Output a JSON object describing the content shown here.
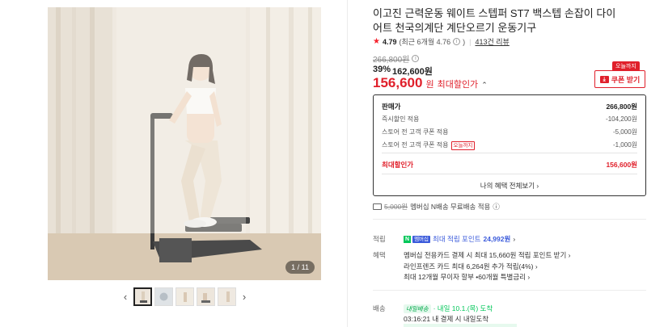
{
  "gallery": {
    "counter": "1 / 11",
    "prev_icon": "chevron-left-icon",
    "next_icon": "chevron-right-icon",
    "prev_glyph": "‹",
    "next_glyph": "›",
    "thumb_count": 5
  },
  "product": {
    "title": "이고진 근력운동 웨이트 스텝퍼 ST7 백스텝 손잡이 다이어트 천국의계단 계단오르기 운동기구",
    "rating_icon": "★",
    "rating": "4.79",
    "rating_recent": "(최근 6개월 4.76",
    "rating_recent_end": ")",
    "review_link": "413건 리뷰"
  },
  "pricing": {
    "original": "266,800원",
    "discount_pct": "39%",
    "sale_price": "162,600원",
    "max_price": "156,600",
    "max_unit": "원",
    "max_label": "최대할인가",
    "max_toggle_icon": "⌃",
    "coupon_badge": "오늘까지",
    "coupon_label": "쿠폰 받기",
    "coupon_icon": "⤓"
  },
  "price_box": {
    "rows": [
      {
        "label": "판매가",
        "value": "266,800원"
      },
      {
        "label": "즉시할인 적용",
        "value": "-104,200원"
      },
      {
        "label": "스토어 전 고객 쿠폰 적용",
        "value": "-5,000원"
      },
      {
        "label": "스토어 전 고객 쿠폰 적용",
        "badge": "오늘까지",
        "value": "-1,000원"
      },
      {
        "label": "최대할인가",
        "value": "156,600원"
      }
    ],
    "benefits_link": "나의 혜택 전체보기 ›"
  },
  "shipping_note": {
    "strike_price": "5,000원",
    "text": "멤버십 N배송 무료배송 적용",
    "info_icon": "ⓘ"
  },
  "points": {
    "label": "적립",
    "membership_tag": "멤버십",
    "n_tag": "N",
    "text": "최대 적립 포인트",
    "amount": "24,992원",
    "chevron": "›"
  },
  "benefits": {
    "label": "혜택",
    "lines": [
      "멤버십 전용카드 결제 시 최대 15,660원 적립 포인트 받기 ›",
      "라인프렌즈 카드 최대 6,264원 추가 적립(4%) ›",
      "최대 12개월 무이자 할부 •60개월 특별금리 ›"
    ]
  },
  "delivery": {
    "label": "배송",
    "badge": "내일배송",
    "arrival": "· 내일 10.1.(목) 도착",
    "sub": "03:16:21  내 결제 시 내일도착"
  }
}
